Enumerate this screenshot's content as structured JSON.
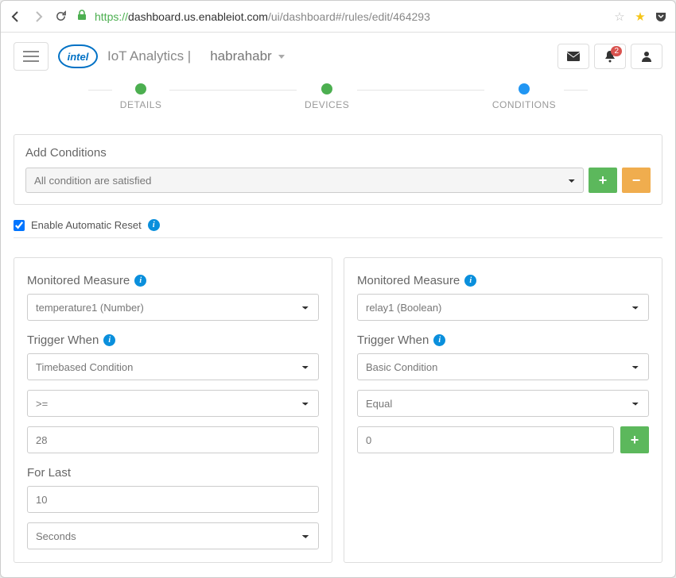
{
  "browser": {
    "url_https": "https://",
    "url_host": "dashboard.us.enableiot.com",
    "url_path": "/ui/dashboard#/rules/edit/464293"
  },
  "header": {
    "brand": "IoT Analytics |",
    "account": "habrahabr",
    "notif_count": "2"
  },
  "steps": [
    {
      "label": "DETAILS",
      "state": "done"
    },
    {
      "label": "DEVICES",
      "state": "done"
    },
    {
      "label": "CONDITIONS",
      "state": "active"
    }
  ],
  "add_conditions": {
    "title": "Add Conditions",
    "selected": "All condition are satisfied"
  },
  "auto_reset": {
    "label": "Enable Automatic Reset",
    "checked": true
  },
  "cards": [
    {
      "measure_label": "Monitored Measure",
      "measure_value": "temperature1 (Number)",
      "trigger_label": "Trigger When",
      "condition_type": "Timebased Condition",
      "operator": ">=",
      "value": "28",
      "for_last_label": "For Last",
      "for_last_value": "10",
      "for_last_unit": "Seconds"
    },
    {
      "measure_label": "Monitored Measure",
      "measure_value": "relay1 (Boolean)",
      "trigger_label": "Trigger When",
      "condition_type": "Basic Condition",
      "operator": "Equal",
      "value": "0"
    }
  ]
}
